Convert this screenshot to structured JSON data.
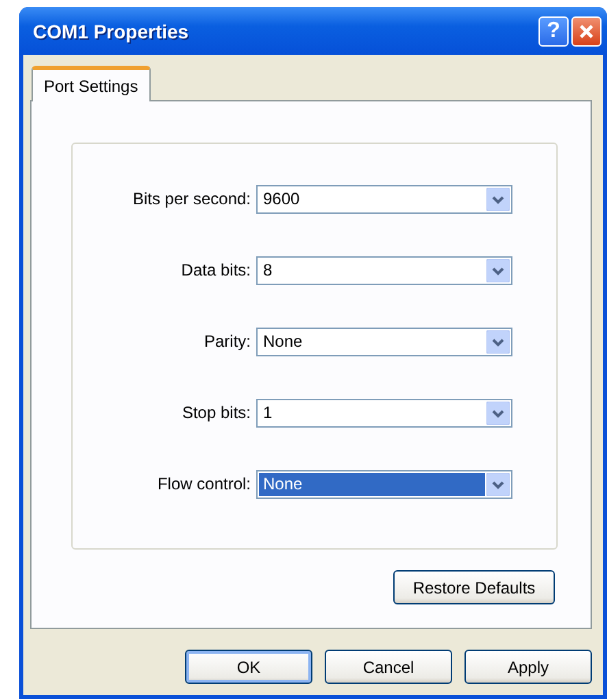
{
  "window": {
    "title": "COM1 Properties",
    "title_buttons": [
      {
        "kind": "help",
        "label": "?"
      },
      {
        "kind": "close"
      }
    ]
  },
  "tabs": [
    {
      "label": "Port Settings",
      "selected": true
    }
  ],
  "fields": [
    {
      "label": "Bits per second:",
      "value": "9600",
      "highlighted": false
    },
    {
      "label": "Data bits:",
      "value": "8",
      "highlighted": false
    },
    {
      "label": "Parity:",
      "value": "None",
      "highlighted": false
    },
    {
      "label": "Stop bits:",
      "value": "1",
      "highlighted": false
    },
    {
      "label": "Flow control:",
      "value": "None",
      "highlighted": true
    }
  ],
  "restore_button": "Restore Defaults",
  "buttons": [
    {
      "label": "OK",
      "default": true
    },
    {
      "label": "Cancel",
      "default": false
    },
    {
      "label": "Apply",
      "default": false
    }
  ]
}
